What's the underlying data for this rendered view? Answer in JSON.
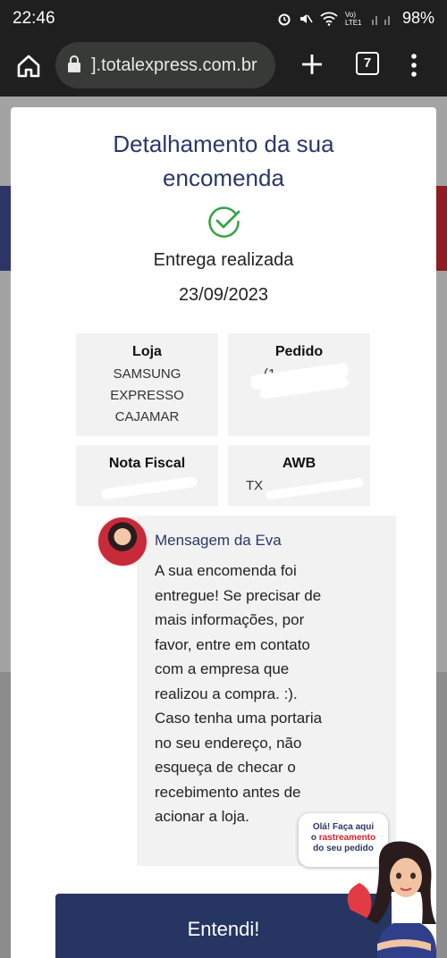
{
  "status_bar": {
    "time": "22:46",
    "battery": "98%",
    "network": "Vo) LTE1"
  },
  "browser": {
    "url": "].totalexpress.com.br",
    "tab_count": "7"
  },
  "modal": {
    "title": "Detalhamento da sua encomenda",
    "status": "Entrega realizada",
    "date": "23/09/2023",
    "loja_label": "Loja",
    "loja_value": "SAMSUNG EXPRESSO CAJAMAR",
    "pedido_label": "Pedido",
    "pedido_value": "(1",
    "nota_label": "Nota Fiscal",
    "nota_value": "",
    "awb_label": "AWB",
    "awb_value": "TX",
    "eva_name": "Mensagem da Eva",
    "eva_message": "A sua encomenda foi entregue! Se precisar de mais informações, por favor, entre em contato com a empresa que realizou a compra. :). Caso tenha uma portaria no seu endereço, não esqueça de checar o recebimento antes de acionar a loja.",
    "button_label": "Entendi!"
  },
  "widget": {
    "line1": "Olá! Faça aqui",
    "line2_prefix": "o",
    "line2_highlight": "rastreamento",
    "line3": "do seu pedido"
  },
  "colors": {
    "primary": "#263562",
    "accent_red": "#d3262f",
    "success": "#3aa24a"
  }
}
